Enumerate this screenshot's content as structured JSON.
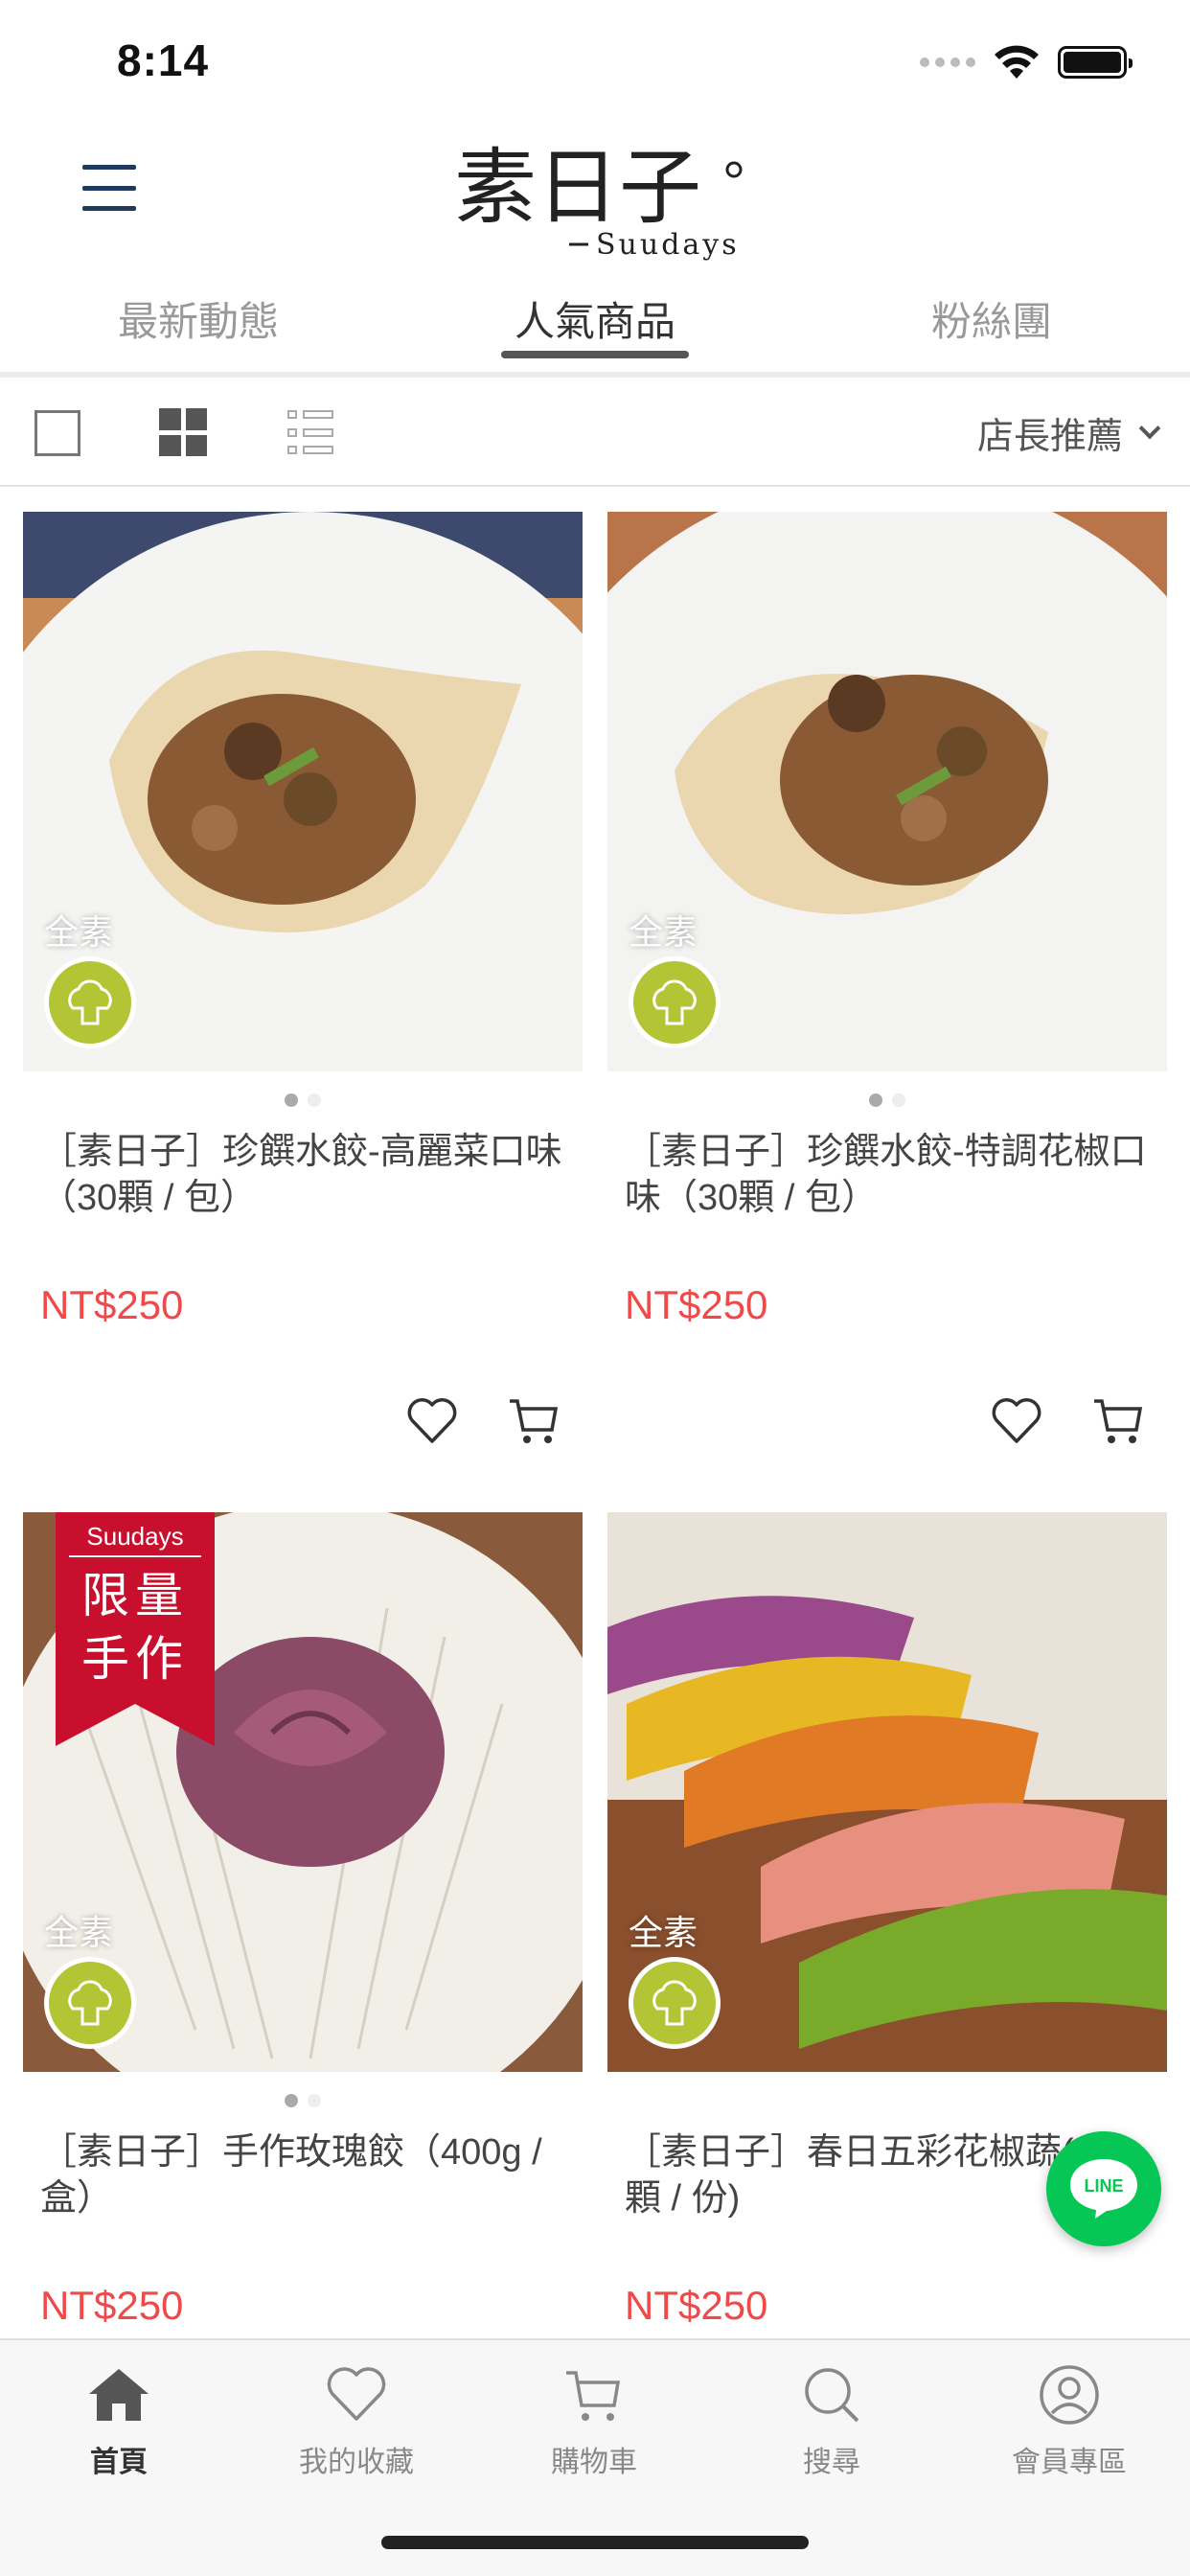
{
  "status_bar": {
    "time": "8:14"
  },
  "header": {
    "logo_text": "Suudays",
    "logo_script": "素日子"
  },
  "tabs": [
    {
      "label": "最新動態",
      "active": false
    },
    {
      "label": "人氣商品",
      "active": true
    },
    {
      "label": "粉絲團",
      "active": false
    }
  ],
  "toolbar": {
    "sort_label": "店長推薦"
  },
  "products": [
    {
      "title": "［素日子］珍饌水餃-高麗菜口味（30顆 / 包）",
      "price": "NT$250",
      "tag": "全素"
    },
    {
      "title": "［素日子］珍饌水餃-特調花椒口味（30顆 / 包）",
      "price": "NT$250",
      "tag": "全素"
    },
    {
      "title": "［素日子］手作玫瑰餃（400g / 盒）",
      "price": "NT$250",
      "tag": "全素",
      "ribbon_brand": "Suudays",
      "ribbon_line1": "限量",
      "ribbon_line2": "手作"
    },
    {
      "title": "［素日子］春日五彩花椒蔬(20顆 / 份)",
      "price": "NT$250",
      "tag": "全素"
    }
  ],
  "line_button": {
    "label": "LINE"
  },
  "bottom_nav": [
    {
      "label": "首頁",
      "icon": "home-icon",
      "active": true
    },
    {
      "label": "我的收藏",
      "icon": "heart-icon",
      "active": false
    },
    {
      "label": "購物車",
      "icon": "cart-icon",
      "active": false
    },
    {
      "label": "搜尋",
      "icon": "search-icon",
      "active": false
    },
    {
      "label": "會員專區",
      "icon": "user-icon",
      "active": false
    }
  ],
  "colors": {
    "price": "#ef4a4a",
    "veg_badge": "#b3c435",
    "ribbon": "#c8102e",
    "line_green": "#06c755",
    "nav_text": "#888888"
  }
}
